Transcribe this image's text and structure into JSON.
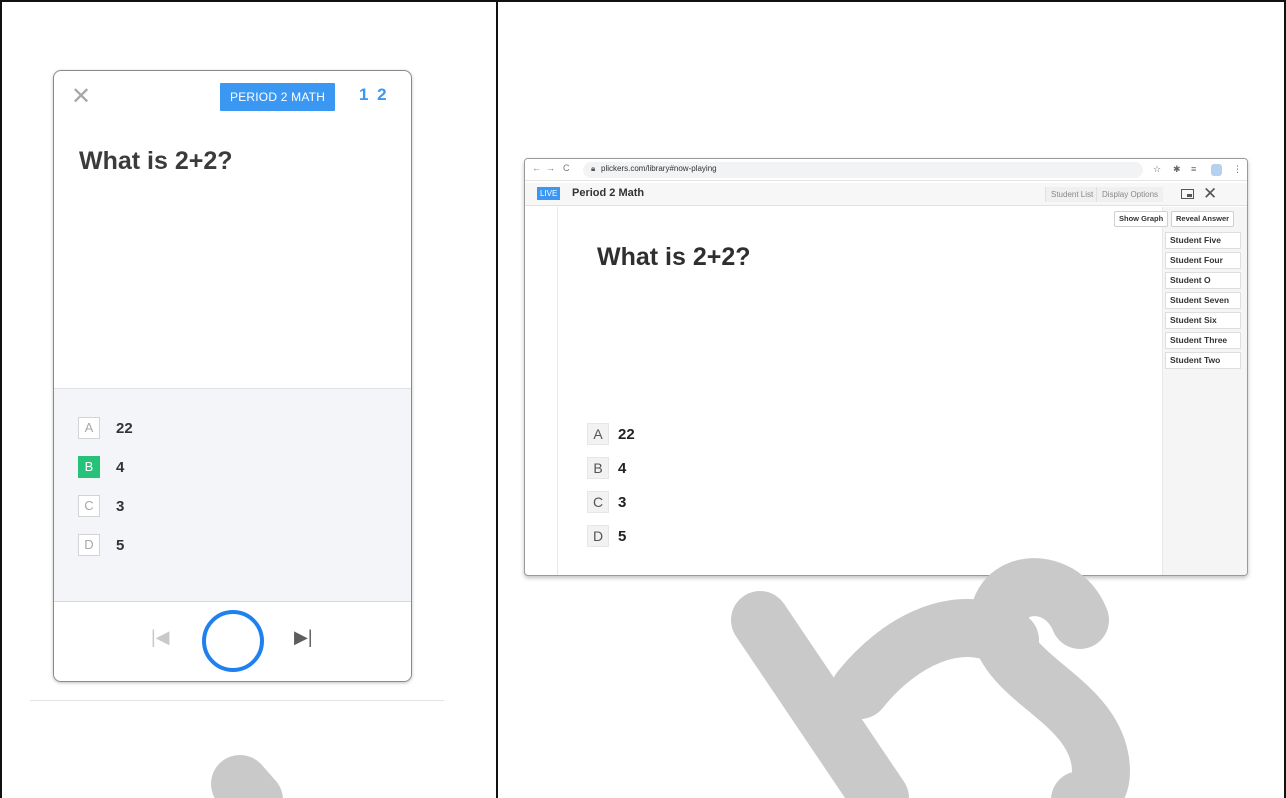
{
  "phone": {
    "class_name": "PERIOD 2 MATH",
    "question_count": "1 2",
    "question": "What is 2+2?",
    "choices": [
      {
        "letter": "A",
        "text": "22",
        "correct": false
      },
      {
        "letter": "B",
        "text": "4",
        "correct": true
      },
      {
        "letter": "C",
        "text": "3",
        "correct": false
      },
      {
        "letter": "D",
        "text": "5",
        "correct": false
      }
    ],
    "icons": {
      "close": "close-icon",
      "prev": "skip-previous-icon",
      "scan": "scan-circle-icon",
      "next": "skip-next-icon"
    }
  },
  "browser": {
    "url": "plickers.com/library#now-playing",
    "live_label": "LIVE",
    "title": "Period 2 Math",
    "student_list_label": "Student List",
    "display_options_label": "Display Options",
    "show_graph_label": "Show Graph",
    "reveal_answer_label": "Reveal Answer",
    "question": "What is 2+2?",
    "choices": [
      {
        "letter": "A",
        "text": "22"
      },
      {
        "letter": "B",
        "text": "4"
      },
      {
        "letter": "C",
        "text": "3"
      },
      {
        "letter": "D",
        "text": "5"
      }
    ],
    "students": [
      "Student Five",
      "Student Four",
      "Student O",
      "Student Seven",
      "Student Six",
      "Student Three",
      "Student Two"
    ]
  },
  "colors": {
    "accent_blue": "#3a97f2",
    "scan_blue": "#1f80f0",
    "correct_green": "#27c27a",
    "watermark_gray": "#c9c9c9"
  }
}
